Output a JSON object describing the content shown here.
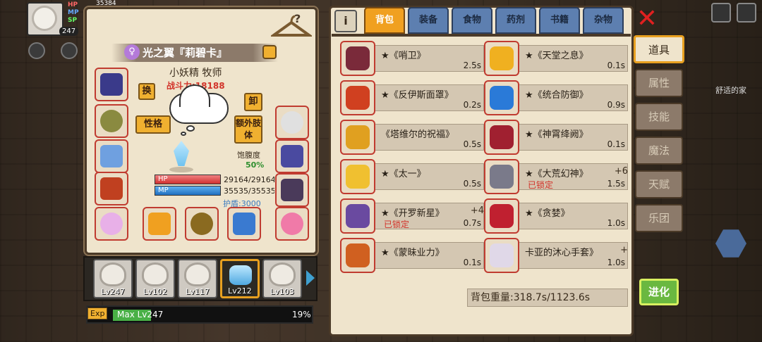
{
  "hud": {
    "hp_label": "HP",
    "mp_label": "MP",
    "sp_label": "SP",
    "level": "247",
    "coins": "35384"
  },
  "character": {
    "name": "光之翼『莉碧卡』",
    "gender_icon": "♀",
    "subtitle": "小妖精 牧师",
    "power": "战斗力:18188",
    "swap_label": "换",
    "unequip_label": "卸",
    "personality_label": "性格",
    "extra_limbs_label": "额外肢体",
    "satiety_label": "饱腹度",
    "satiety_value": "50%",
    "hp_bar_label": "HP",
    "hp_value": "29164/29164",
    "mp_bar_label": "MP",
    "mp_value": "35535/35535",
    "shield": "护盾:3000"
  },
  "team": [
    {
      "level": "Lv247"
    },
    {
      "level": "Lv102"
    },
    {
      "level": "Lv117"
    },
    {
      "level": "Lv212"
    },
    {
      "level": "Lv103"
    }
  ],
  "exp": {
    "tag": "Exp",
    "text": "Max Lv247",
    "percent": "19%",
    "percent_fraction": 0.19
  },
  "tabs": [
    "背包",
    "装备",
    "食物",
    "药剂",
    "书籍",
    "杂物"
  ],
  "info_label": "i",
  "items": [
    {
      "name": "★《哨卫》",
      "time": "2.5s",
      "lock": "",
      "plus": "",
      "icon": "helmet-icon",
      "color": "#7a2a3a"
    },
    {
      "name": "★《天堂之息》",
      "time": "0.1s",
      "lock": "",
      "plus": "",
      "icon": "crown-icon",
      "color": "#f0b020"
    },
    {
      "name": "★《反伊斯面罩》",
      "time": "0.2s",
      "lock": "",
      "plus": "",
      "icon": "mask-icon",
      "color": "#d04020"
    },
    {
      "name": "★《统合防御》",
      "time": "0.9s",
      "lock": "",
      "plus": "",
      "icon": "gem-icon",
      "color": "#2a7ad8"
    },
    {
      "name": "《塔维尔的祝福》",
      "time": "0.5s",
      "lock": "",
      "plus": "",
      "icon": "bracelet-icon",
      "color": "#e0a020"
    },
    {
      "name": "★《神霄绛阙》",
      "time": "0.1s",
      "lock": "",
      "plus": "",
      "icon": "necklace-icon",
      "color": "#a02030"
    },
    {
      "name": "★《太一》",
      "time": "0.5s",
      "lock": "",
      "plus": "",
      "icon": "wing-icon",
      "color": "#f0c030"
    },
    {
      "name": "★《大荒幻神》",
      "time": "1.5s",
      "lock": "已锁定",
      "plus": "+6",
      "icon": "axe-icon",
      "color": "#7a7a8a"
    },
    {
      "name": "★《开罗新星》",
      "time": "0.7s",
      "lock": "已锁定",
      "plus": "+4",
      "icon": "sword-icon",
      "color": "#6a4aa0"
    },
    {
      "name": "★《贪婪》",
      "time": "1.0s",
      "lock": "",
      "plus": "",
      "icon": "spear-icon",
      "color": "#c02030"
    },
    {
      "name": "★《蒙昧业力》",
      "time": "0.1s",
      "lock": "",
      "plus": "",
      "icon": "staff-icon",
      "color": "#d06020"
    },
    {
      "name": "卡亚的沐心手套》",
      "time": "1.0s",
      "lock": "",
      "plus": "+",
      "icon": "glove-icon",
      "color": "#e0d8e8"
    }
  ],
  "weight": "背包重量:318.7s/1123.6s",
  "side_menu": [
    "道具",
    "属性",
    "技能",
    "魔法",
    "天赋",
    "乐团"
  ],
  "evolve_label": "进化",
  "close_label": "✕",
  "home_label": "舒适的家"
}
